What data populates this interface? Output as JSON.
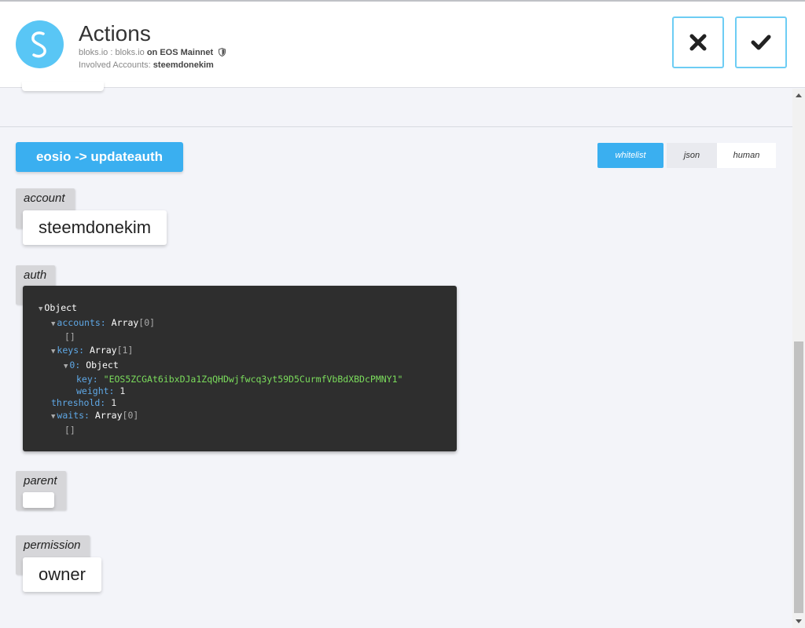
{
  "header": {
    "title": "Actions",
    "origin": "bloks.io : bloks.io",
    "network_prefix": "on",
    "network": "EOS Mainnet",
    "involved_label": "Involved Accounts:",
    "involved_account": "steemdonekim",
    "reject_icon": "close-icon",
    "accept_icon": "check-icon"
  },
  "action": {
    "label": "eosio -> updateauth",
    "tabs": [
      "whitelist",
      "json",
      "human"
    ],
    "active_tab": "whitelist"
  },
  "fields": {
    "account": {
      "label": "account",
      "value": "steemdonekim"
    },
    "auth": {
      "label": "auth"
    },
    "parent": {
      "label": "parent",
      "value": ""
    },
    "permission": {
      "label": "permission",
      "value": "owner"
    }
  },
  "auth_tree": {
    "root": "Object",
    "accounts_key": "accounts:",
    "accounts_type": "Array",
    "accounts_count": "[0]",
    "accounts_empty": "[]",
    "keys_key": "keys:",
    "keys_type": "Array",
    "keys_count": "[1]",
    "key0_index": "0:",
    "key0_type": "Object",
    "key_key": "key:",
    "key_value": "\"EOS5ZCGAt6ibxDJa1ZqQHDwjfwcq3yt59D5CurmfVbBdXBDcPMNY1\"",
    "weight_key": "weight:",
    "weight_value": "1",
    "threshold_key": "threshold:",
    "threshold_value": "1",
    "waits_key": "waits:",
    "waits_type": "Array",
    "waits_count": "[0]",
    "waits_empty": "[]"
  },
  "colors": {
    "accent": "#3aaff0",
    "logo": "#59c6f5",
    "code_bg": "#2e2e2e",
    "string": "#7bdc5c",
    "key": "#5fa8e6"
  }
}
